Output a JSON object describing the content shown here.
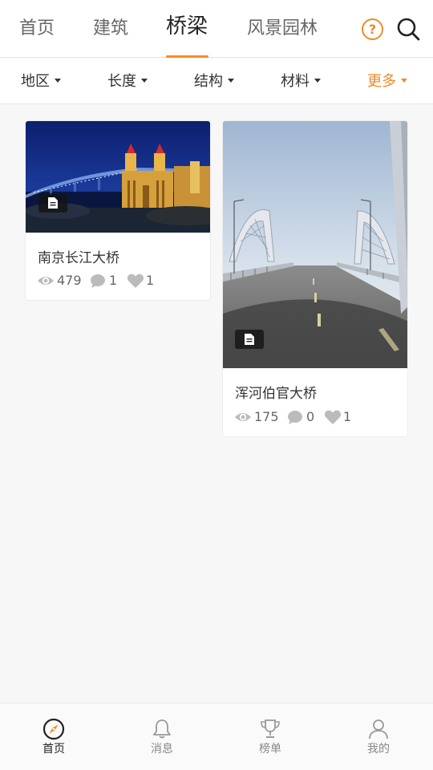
{
  "top_tabs": [
    {
      "label": "首页"
    },
    {
      "label": "建筑"
    },
    {
      "label": "桥梁",
      "active": true
    },
    {
      "label": "风景园林"
    }
  ],
  "help_icon": {
    "name": "help-circle-icon",
    "glyph": "?"
  },
  "search_icon": {
    "name": "search-icon"
  },
  "filters": [
    {
      "label": "地区"
    },
    {
      "label": "长度"
    },
    {
      "label": "结构"
    },
    {
      "label": "材料"
    },
    {
      "label": "更多",
      "highlight": true
    }
  ],
  "cards": [
    {
      "title": "南京长江大桥",
      "views": "479",
      "comments": "1",
      "likes": "1",
      "badge_icon": "document-icon"
    },
    {
      "title": "浑河伯官大桥",
      "views": "175",
      "comments": "0",
      "likes": "1",
      "badge_icon": "document-icon"
    }
  ],
  "bottom_nav": [
    {
      "label": "首页",
      "icon": "compass-icon",
      "active": true
    },
    {
      "label": "消息",
      "icon": "bell-icon"
    },
    {
      "label": "榜单",
      "icon": "trophy-icon"
    },
    {
      "label": "我的",
      "icon": "user-icon"
    }
  ],
  "colors": {
    "accent": "#f08a24",
    "tab_underline": "#ff8a1f",
    "background": "#f7f7f7",
    "text": "#333333",
    "muted": "#999999"
  }
}
